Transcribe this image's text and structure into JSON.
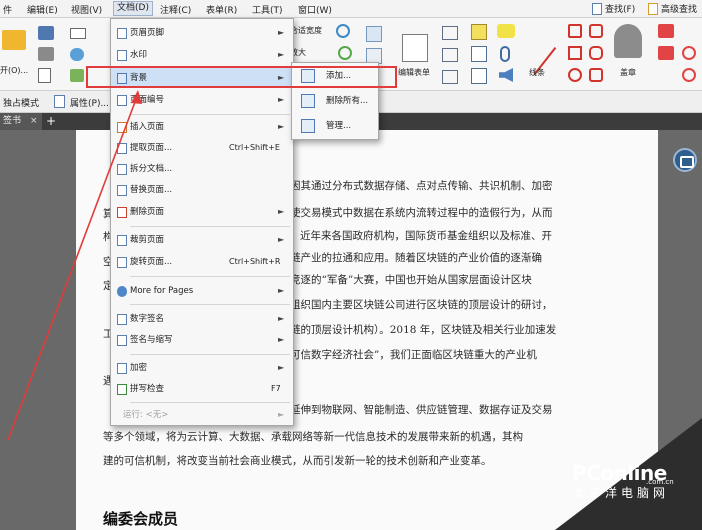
{
  "menubar": {
    "items": [
      "件",
      "编辑(E)",
      "视图(V)",
      "文档(D)",
      "注释(C)",
      "表单(R)",
      "工具(T)",
      "窗口(W)"
    ],
    "right": [
      "查找(F)",
      "高级查找"
    ]
  },
  "ribbon": {
    "fit_label": "合适宽度",
    "zoom_label": "放大",
    "edit_form_label": "编辑表单",
    "line_label": "线条",
    "sign_label": "盖章",
    "open_label": "开(O)..."
  },
  "quickbar": {
    "exclusive_mode": "独占模式",
    "properties": "属性(P)..."
  },
  "tab": {
    "label": "签书",
    "close": "×",
    "add": "+"
  },
  "document_menu": {
    "items": [
      {
        "label": "页眉页脚",
        "shortcut": "",
        "arrow": "►",
        "icon": "header-footer-icon"
      },
      {
        "label": "水印",
        "shortcut": "",
        "arrow": "►",
        "icon": "watermark-icon"
      },
      {
        "label": "背景",
        "shortcut": "",
        "arrow": "►",
        "icon": "background-icon",
        "highlighted": true
      },
      {
        "label": "页面编号",
        "shortcut": "",
        "arrow": "►",
        "icon": "page-number-icon"
      },
      {
        "label": "插入页面",
        "shortcut": "",
        "arrow": "►",
        "icon": "insert-page-icon"
      },
      {
        "label": "提取页面...",
        "shortcut": "Ctrl+Shift+E",
        "arrow": "",
        "icon": "extract-page-icon"
      },
      {
        "label": "拆分文档...",
        "shortcut": "",
        "arrow": "",
        "icon": "split-doc-icon"
      },
      {
        "label": "替换页面...",
        "shortcut": "",
        "arrow": "",
        "icon": "replace-page-icon"
      },
      {
        "label": "删除页面",
        "shortcut": "",
        "arrow": "►",
        "icon": "delete-page-icon"
      },
      {
        "label": "裁剪页面",
        "shortcut": "",
        "arrow": "►",
        "icon": "crop-page-icon"
      },
      {
        "label": "旋转页面...",
        "shortcut": "Ctrl+Shift+R",
        "arrow": "",
        "icon": "rotate-page-icon"
      },
      {
        "label": "More for Pages",
        "shortcut": "",
        "arrow": "►",
        "icon": "more-pages-icon"
      },
      {
        "label": "数字签名",
        "shortcut": "",
        "arrow": "►",
        "icon": "digital-sign-icon"
      },
      {
        "label": "签名与缩写",
        "shortcut": "",
        "arrow": "►",
        "icon": "sign-initials-icon"
      },
      {
        "label": "加密",
        "shortcut": "",
        "arrow": "►",
        "icon": "encrypt-icon"
      },
      {
        "label": "拼写检查",
        "shortcut": "F7",
        "arrow": "",
        "icon": "spell-check-icon"
      },
      {
        "label": "运行: <无>",
        "shortcut": "",
        "arrow": "►",
        "icon": "",
        "disabled": true
      }
    ]
  },
  "background_submenu": {
    "items": [
      {
        "label": "添加...",
        "icon": "add-background-icon"
      },
      {
        "label": "删除所有...",
        "icon": "remove-all-icon"
      },
      {
        "label": "管理...",
        "icon": "manage-icon"
      }
    ]
  },
  "document": {
    "lines": [
      "因其通过分布式数据存储、点对点传输、共识机制、加密",
      "使交易模式中数据在系统内流转过程中的造假行为，从而",
      "近年来各国政府机构，国际货币基金组织以及标准、开",
      "链产业的拉通和应用。随着区块链的产业价值的逐渐确",
      "竞逐的“军备”大赛，中国也开始从国家层面设计区块",
      "组织国内主要区块链公司进行区块链的顶层设计的研讨，",
      "链的顶层设计机构）。2018 年，区块链及相关行业加速发",
      "可信数字经济社会”，我们正面临区块链重大的产业机",
      "延伸到物联网、智能制造、供应链管理、数据存证及交易",
      "等多个领域，将为云计算、大数据、承载网络等新一代信息技术的发展带来新的机遇，其构",
      "建的可信机制，将改变当前社会商业模式，从而引发新一轮的技术创新和产业变革。"
    ],
    "left_fragments": [
      "算",
      "构",
      "空",
      "定",
      "工",
      "遇"
    ],
    "heading": "编委会成员"
  },
  "watermark": {
    "logo": "PConline",
    "domain": ".com.cn",
    "subtitle": "太平洋电脑网"
  },
  "colors": {
    "highlight_red": "#e23b3b",
    "menu_highlight": "#cde0f5"
  }
}
